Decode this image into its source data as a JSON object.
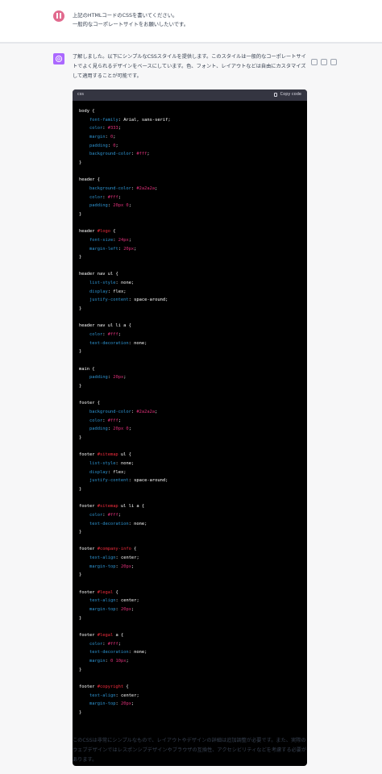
{
  "user_message": {
    "lines": [
      "上記のHTMLコードのCSSを書いてください。",
      "一般的なコーポレートサイトをお願いしたいです。"
    ]
  },
  "assistant_message": {
    "intro": "了解しました。以下にシンプルなCSSスタイルを提供します。このスタイルは一般的なコーポレートサイトでよく見られるデザインをベースにしています。色、フォント、レイアウトなどは自由にカスタマイズして適用することが可能です。",
    "code_language": "css",
    "copy_label": "Copy code",
    "outro": "このCSSは非常にシンプルなもので、レイアウトやデザインの詳細は追加調整が必要です。また、実際のウェブデザインではレスポンシブデザインやブラウザの互換性、アクセシビリティなどを考慮する必要があります。"
  },
  "code_rules": [
    {
      "selector": [
        [
          "sel",
          "body"
        ]
      ],
      "decls": [
        [
          "font-family",
          "Arial, sans-serif"
        ],
        [
          "color",
          "#333"
        ],
        [
          "margin",
          "0"
        ],
        [
          "padding",
          "0"
        ],
        [
          "background-color",
          "#fff"
        ]
      ]
    },
    {
      "selector": [
        [
          "sel",
          "header"
        ]
      ],
      "decls": [
        [
          "background-color",
          "#2a2a2a"
        ],
        [
          "color",
          "#fff"
        ],
        [
          "padding",
          "20px 0"
        ]
      ]
    },
    {
      "selector": [
        [
          "sel",
          "header "
        ],
        [
          "id",
          "#logo"
        ]
      ],
      "decls": [
        [
          "font-size",
          "24px"
        ],
        [
          "margin-left",
          "20px"
        ]
      ]
    },
    {
      "selector": [
        [
          "sel",
          "header nav ul"
        ]
      ],
      "decls": [
        [
          "list-style",
          "none"
        ],
        [
          "display",
          "flex"
        ],
        [
          "justify-content",
          "space-around"
        ]
      ]
    },
    {
      "selector": [
        [
          "sel",
          "header nav ul li a"
        ]
      ],
      "decls": [
        [
          "color",
          "#fff"
        ],
        [
          "text-decoration",
          "none"
        ]
      ]
    },
    {
      "selector": [
        [
          "sel",
          "main"
        ]
      ],
      "decls": [
        [
          "padding",
          "20px"
        ]
      ]
    },
    {
      "selector": [
        [
          "sel",
          "footer"
        ]
      ],
      "decls": [
        [
          "background-color",
          "#2a2a2a"
        ],
        [
          "color",
          "#fff"
        ],
        [
          "padding",
          "20px 0"
        ]
      ]
    },
    {
      "selector": [
        [
          "sel",
          "footer "
        ],
        [
          "id",
          "#sitemap"
        ],
        [
          "sel",
          " ul"
        ]
      ],
      "decls": [
        [
          "list-style",
          "none"
        ],
        [
          "display",
          "flex"
        ],
        [
          "justify-content",
          "space-around"
        ]
      ]
    },
    {
      "selector": [
        [
          "sel",
          "footer "
        ],
        [
          "id",
          "#sitemap"
        ],
        [
          "sel",
          " ul li a"
        ]
      ],
      "decls": [
        [
          "color",
          "#fff"
        ],
        [
          "text-decoration",
          "none"
        ]
      ]
    },
    {
      "selector": [
        [
          "sel",
          "footer "
        ],
        [
          "id",
          "#company-info"
        ]
      ],
      "decls": [
        [
          "text-align",
          "center"
        ],
        [
          "margin-top",
          "20px"
        ]
      ]
    },
    {
      "selector": [
        [
          "sel",
          "footer "
        ],
        [
          "id",
          "#legal"
        ]
      ],
      "decls": [
        [
          "text-align",
          "center"
        ],
        [
          "margin-top",
          "20px"
        ]
      ]
    },
    {
      "selector": [
        [
          "sel",
          "footer "
        ],
        [
          "id",
          "#legal"
        ],
        [
          "sel",
          " a"
        ]
      ],
      "decls": [
        [
          "color",
          "#fff"
        ],
        [
          "text-decoration",
          "none"
        ],
        [
          "margin",
          "0 10px"
        ]
      ]
    },
    {
      "selector": [
        [
          "sel",
          "footer "
        ],
        [
          "id",
          "#copyright"
        ]
      ],
      "decls": [
        [
          "text-align",
          "center"
        ],
        [
          "margin-top",
          "20px"
        ]
      ]
    }
  ]
}
